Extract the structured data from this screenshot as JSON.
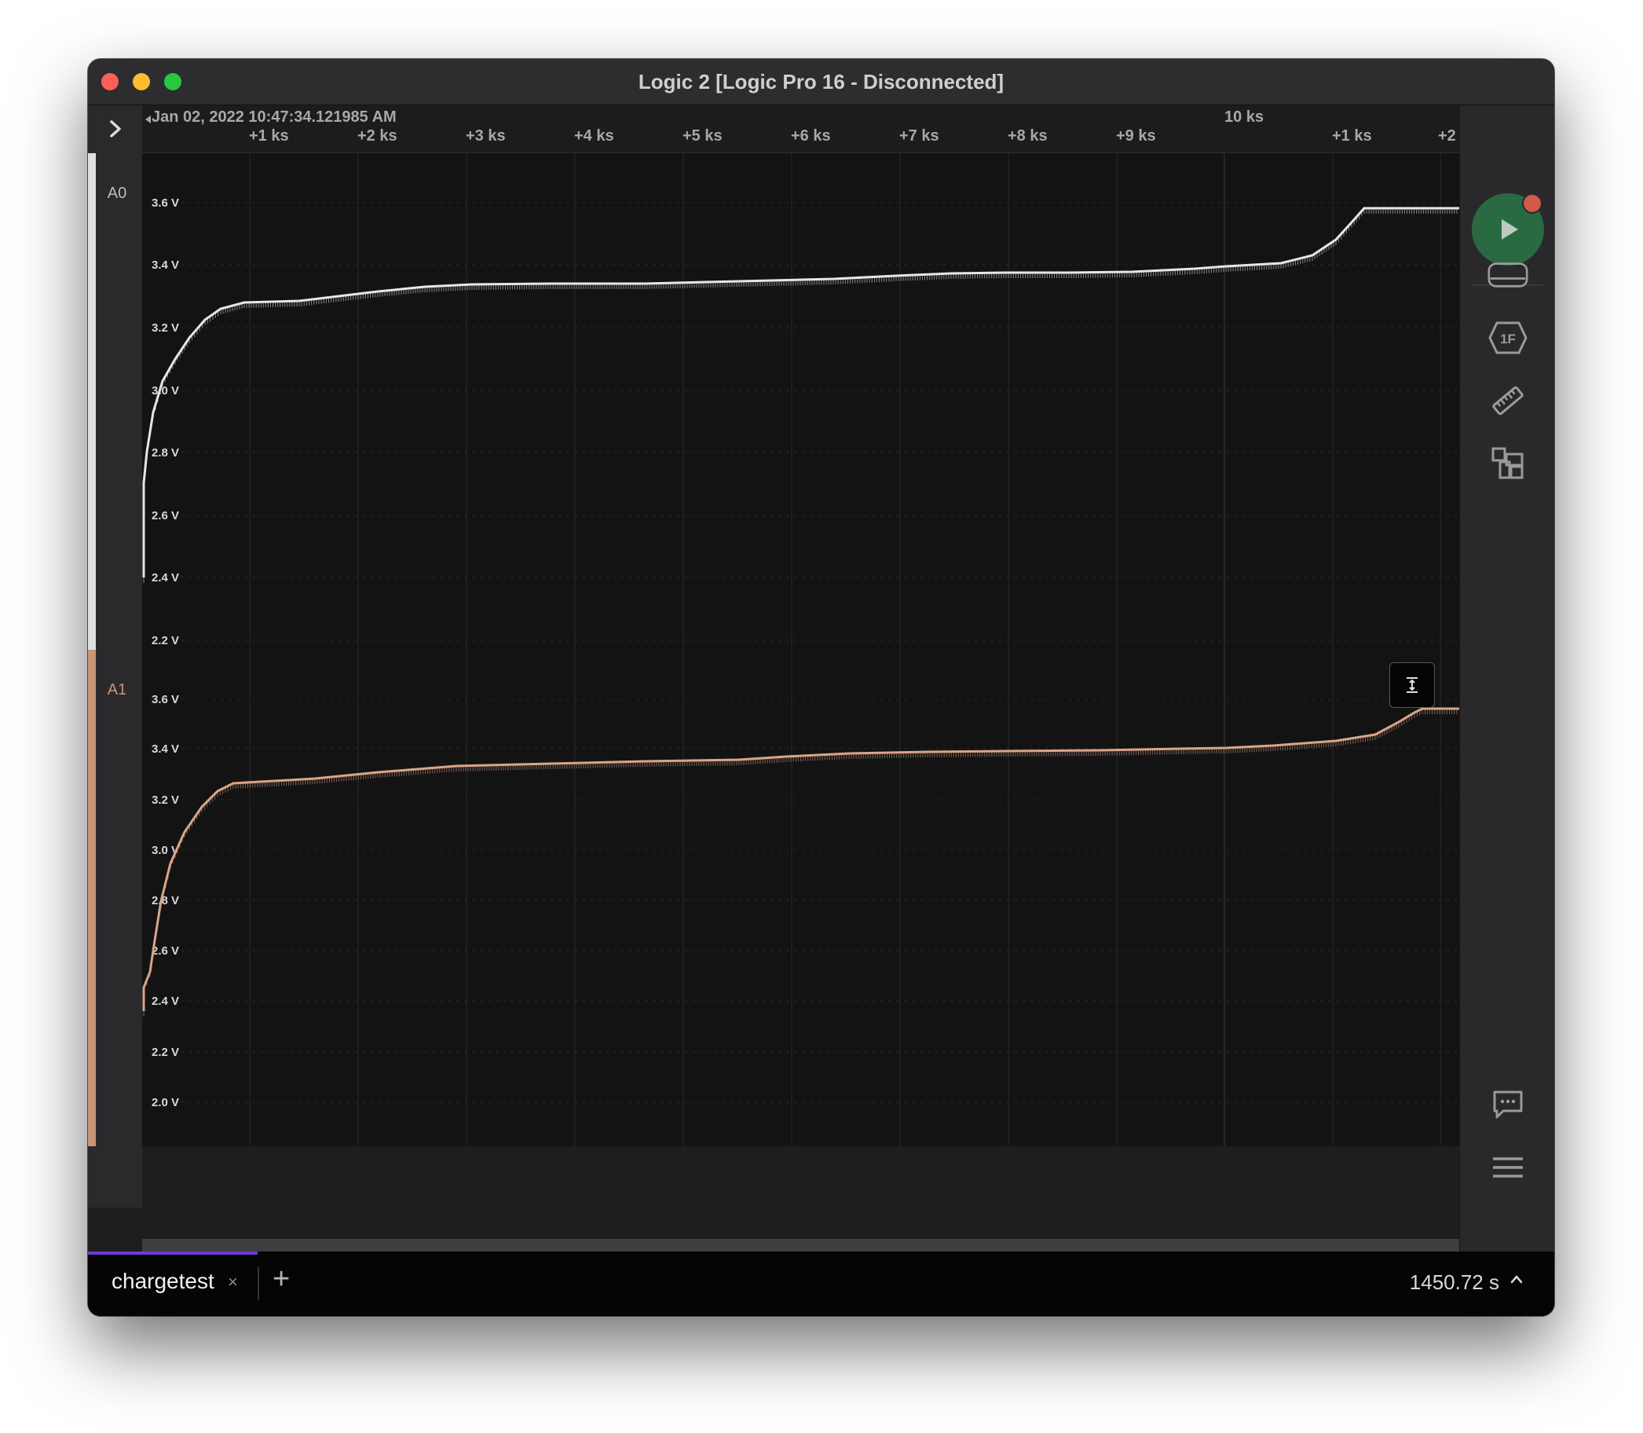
{
  "window": {
    "title": "Logic 2 [Logic Pro 16 - Disconnected]"
  },
  "ruler": {
    "start_timestamp": "Jan 02, 2022 10:47:34.121985 AM",
    "major_marker": "10 ks",
    "ticks": [
      "+1 ks",
      "+2 ks",
      "+3 ks",
      "+4 ks",
      "+5 ks",
      "+6 ks",
      "+7 ks",
      "+8 ks",
      "+9 ks",
      "+1 ks",
      "+2"
    ]
  },
  "channels": [
    {
      "name": "A0",
      "color": "#e6e6e6",
      "bar_color": "#e0e0e0",
      "y_labels": [
        "3.6 V",
        "3.4 V",
        "3.2 V",
        "3.0 V",
        "2.8 V",
        "2.6 V",
        "2.4 V",
        "2.2 V"
      ]
    },
    {
      "name": "A1",
      "color": "#d9a587",
      "bar_color": "#c99577",
      "y_labels": [
        "3.6 V",
        "3.4 V",
        "3.2 V",
        "3.0 V",
        "2.8 V",
        "2.6 V",
        "2.4 V",
        "2.2 V",
        "2.0 V"
      ]
    }
  ],
  "tabs": [
    {
      "label": "chargetest",
      "close": "×"
    }
  ],
  "tab_add": "+",
  "status": {
    "duration": "1450.72 s"
  },
  "right_panel": {
    "icons": [
      "play-icon",
      "device-icon",
      "analyzer-icon",
      "ruler-icon",
      "extensions-icon",
      "feedback-icon",
      "menu-icon"
    ],
    "analyzer_badge": "1F"
  },
  "colors": {
    "play_button": "#2a6a42",
    "record_dot": "#d25a4a",
    "tab_indicator": "#6f3bd6"
  }
}
